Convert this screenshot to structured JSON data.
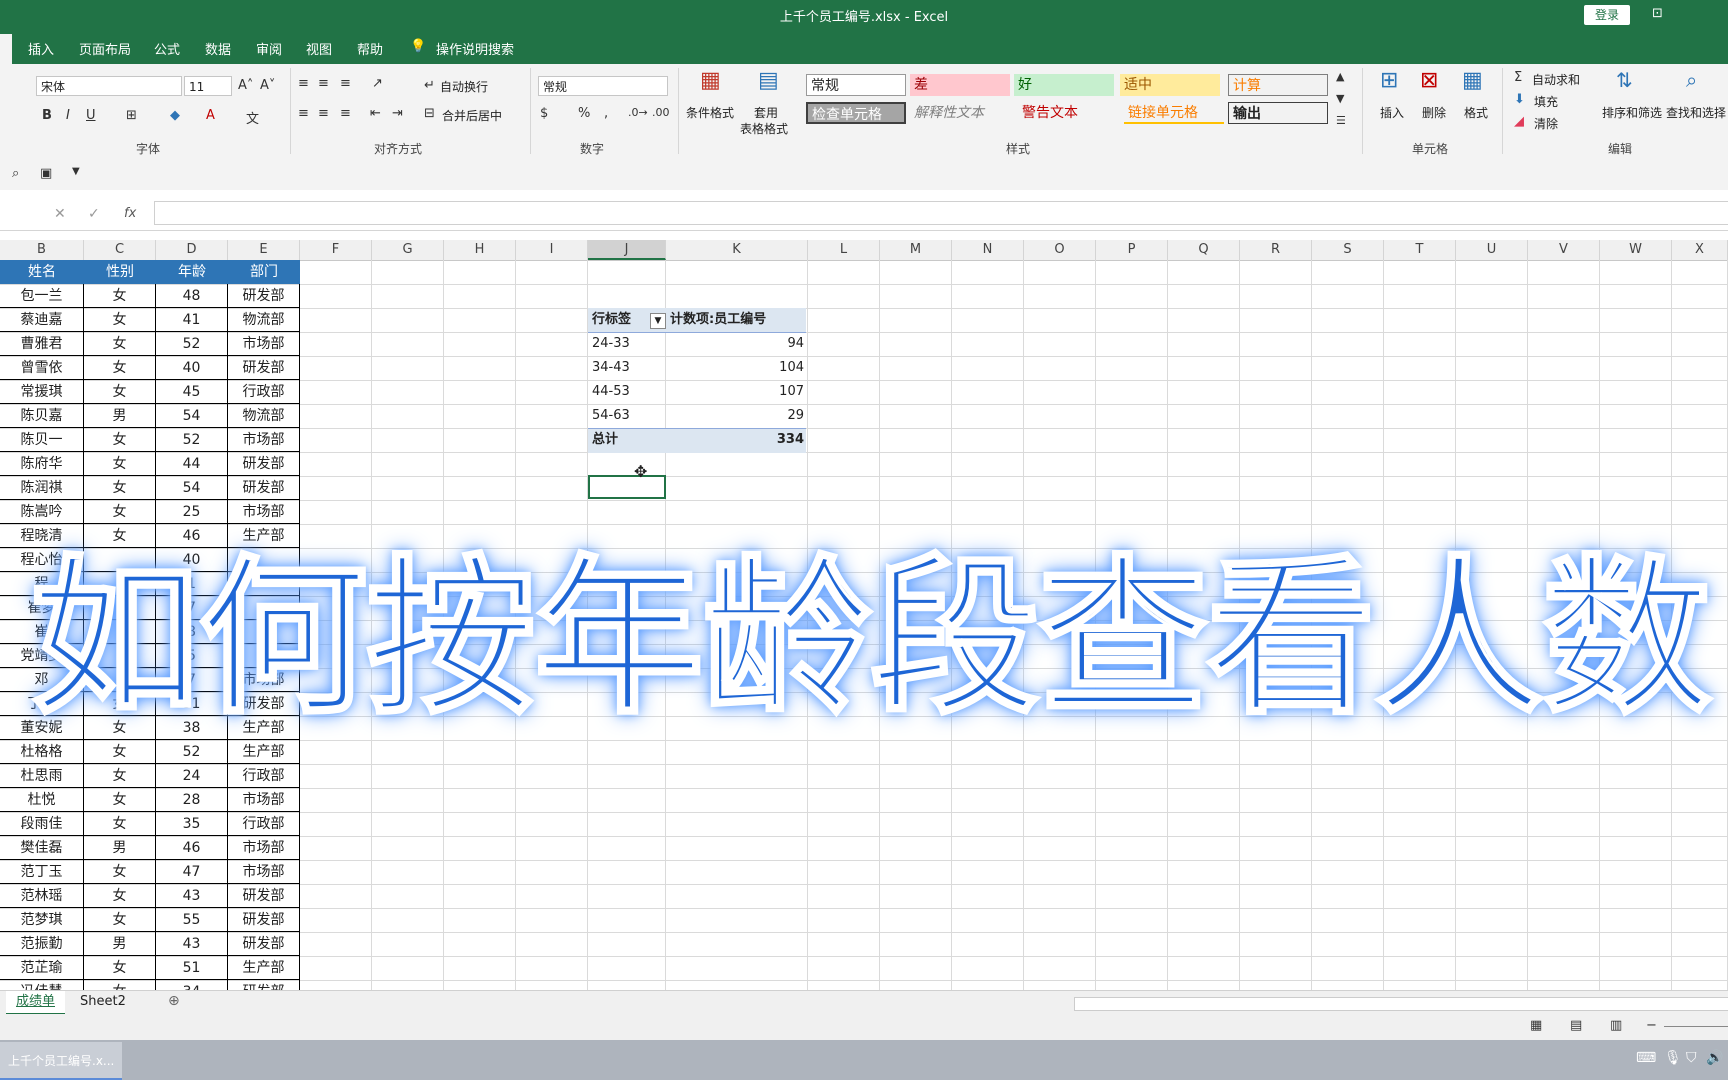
{
  "window": {
    "title": "上千个员工编号.xlsx  -  Excel",
    "login_label": "登录"
  },
  "menu": {
    "tabs": [
      "插入",
      "页面布局",
      "公式",
      "数据",
      "审阅",
      "视图",
      "帮助"
    ],
    "tell_me": "操作说明搜索"
  },
  "ribbon": {
    "font_name": "宋体",
    "font_size": "11",
    "group_font": "字体",
    "group_align": "对齐方式",
    "group_number": "数字",
    "group_styles": "样式",
    "group_cells": "单元格",
    "group_edit": "编辑",
    "wrap_text": "自动换行",
    "merge_center": "合并后居中",
    "number_format": "常规",
    "cond_format": "条件格式",
    "table_format_1": "套用",
    "table_format_2": "表格格式",
    "styles": {
      "normal": "常规",
      "bad": "差",
      "good": "好",
      "neutral": "适中",
      "calc": "计算",
      "check": "检查单元格",
      "explain": "解释性文本",
      "warn": "警告文本",
      "link": "链接单元格",
      "output": "输出"
    },
    "insert": "插入",
    "delete": "删除",
    "format": "格式",
    "autosum": "自动求和",
    "fill": "填充",
    "clear": "清除",
    "sort_filter": "排序和筛选",
    "find_select": "查找和选择",
    "bold": "B",
    "italic": "I",
    "underline": "U",
    "percent": "%",
    "comma": ","
  },
  "formula_bar": {
    "fx": "fx"
  },
  "columns": [
    "B",
    "C",
    "D",
    "E",
    "F",
    "G",
    "H",
    "I",
    "J",
    "K",
    "L",
    "M",
    "N",
    "O",
    "P",
    "Q",
    "R",
    "S",
    "T",
    "U",
    "V",
    "W",
    "X"
  ],
  "table": {
    "headers": [
      "姓名",
      "性别",
      "年龄",
      "部门"
    ],
    "rows": [
      [
        "包一兰",
        "女",
        "48",
        "研发部"
      ],
      [
        "蔡迪嘉",
        "女",
        "41",
        "物流部"
      ],
      [
        "曹雅君",
        "女",
        "52",
        "市场部"
      ],
      [
        "曾雪依",
        "女",
        "40",
        "研发部"
      ],
      [
        "常援琪",
        "女",
        "45",
        "行政部"
      ],
      [
        "陈贝嘉",
        "男",
        "54",
        "物流部"
      ],
      [
        "陈贝一",
        "女",
        "52",
        "市场部"
      ],
      [
        "陈府华",
        "女",
        "44",
        "研发部"
      ],
      [
        "陈润祺",
        "女",
        "54",
        "研发部"
      ],
      [
        "陈嵩吟",
        "女",
        "25",
        "市场部"
      ],
      [
        "程晓清",
        "女",
        "46",
        "生产部"
      ],
      [
        "程心怡",
        "",
        "40",
        ""
      ],
      [
        "程",
        "",
        "1",
        ""
      ],
      [
        "崔梦",
        "",
        "7",
        ""
      ],
      [
        "崔",
        "",
        "8",
        ""
      ],
      [
        "党靖雯",
        "",
        "5",
        ""
      ],
      [
        "邓",
        "",
        "7",
        "市场部"
      ],
      [
        "丁雪",
        "女",
        "51",
        "研发部"
      ],
      [
        "董安妮",
        "女",
        "38",
        "生产部"
      ],
      [
        "杜格格",
        "女",
        "52",
        "生产部"
      ],
      [
        "杜思雨",
        "女",
        "24",
        "行政部"
      ],
      [
        "杜悦",
        "女",
        "28",
        "市场部"
      ],
      [
        "段雨佳",
        "女",
        "35",
        "行政部"
      ],
      [
        "樊佳磊",
        "男",
        "46",
        "市场部"
      ],
      [
        "范丁玉",
        "女",
        "47",
        "市场部"
      ],
      [
        "范林瑶",
        "女",
        "43",
        "研发部"
      ],
      [
        "范梦琪",
        "女",
        "55",
        "研发部"
      ],
      [
        "范振勤",
        "男",
        "43",
        "研发部"
      ],
      [
        "范芷瑜",
        "女",
        "51",
        "生产部"
      ],
      [
        "冯佳慧",
        "女",
        "34",
        "研发部"
      ]
    ]
  },
  "pivot": {
    "row_label": "行标签",
    "value_label": "计数项:员工编号",
    "rows": [
      [
        "24-33",
        "94"
      ],
      [
        "34-43",
        "104"
      ],
      [
        "44-53",
        "107"
      ],
      [
        "54-63",
        "29"
      ]
    ],
    "total_label": "总计",
    "total_value": "334"
  },
  "overlay_text": "如何按年龄段查看人数",
  "sheets": [
    "成绩单",
    "Sheet2"
  ],
  "taskbar": {
    "app_label": "上千个员工编号.x..."
  }
}
